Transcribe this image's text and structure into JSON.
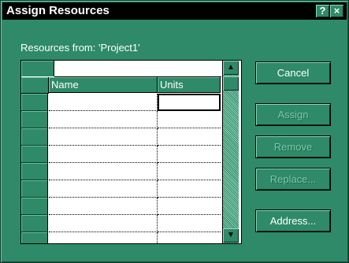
{
  "window": {
    "title": "Assign Resources",
    "help_glyph": "?",
    "close_glyph": "×"
  },
  "resources_from": "Resources from:  'Project1'",
  "grid": {
    "entry_value": "",
    "columns": [
      "Name",
      "Units"
    ],
    "rows": [
      {
        "name": "",
        "units": ""
      },
      {
        "name": "",
        "units": ""
      },
      {
        "name": "",
        "units": ""
      },
      {
        "name": "",
        "units": ""
      },
      {
        "name": "",
        "units": ""
      },
      {
        "name": "",
        "units": ""
      },
      {
        "name": "",
        "units": ""
      },
      {
        "name": "",
        "units": ""
      },
      {
        "name": "",
        "units": ""
      }
    ]
  },
  "buttons": {
    "cancel": "Cancel",
    "assign": "Assign",
    "remove": "Remove",
    "replace": "Replace...",
    "address": "Address..."
  },
  "icons": {
    "scroll_up": "up-arrow-icon",
    "scroll_down": "down-arrow-icon"
  },
  "colors": {
    "face": "#2e8a68",
    "titlebar": "#000000"
  }
}
